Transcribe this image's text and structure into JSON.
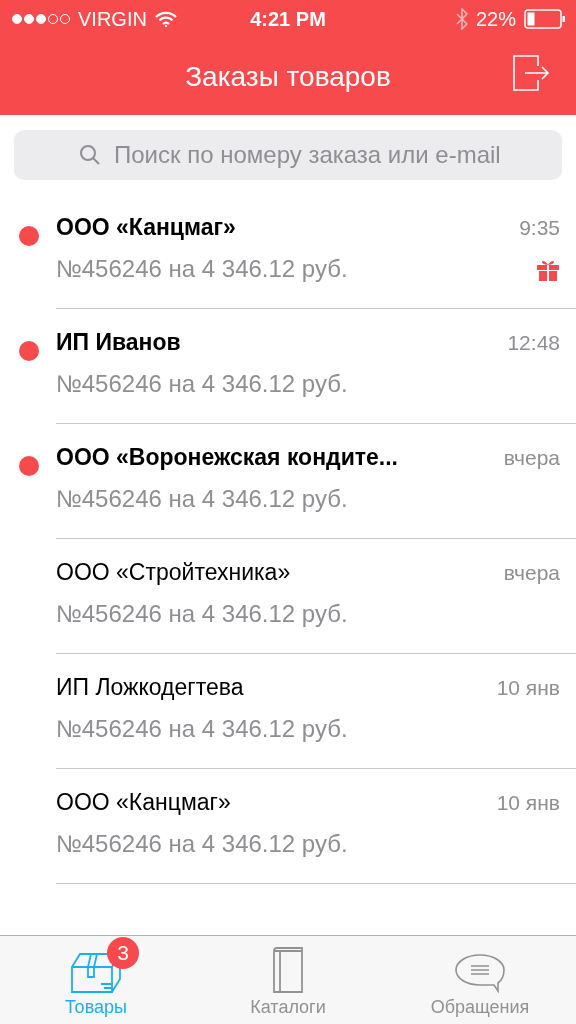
{
  "status_bar": {
    "carrier": "VIRGIN",
    "time": "4:21 PM",
    "battery": "22%"
  },
  "header": {
    "title": "Заказы товаров"
  },
  "search": {
    "placeholder": "Поиск по номеру заказа или e-mail"
  },
  "orders": [
    {
      "name": "ООО «Канцмаг»",
      "details": "№456246 на 4 346.12 руб.",
      "time": "9:35",
      "unread": true,
      "gift": true
    },
    {
      "name": "ИП Иванов",
      "details": "№456246 на 4 346.12 руб.",
      "time": "12:48",
      "unread": true,
      "gift": false
    },
    {
      "name": "ООО «Воронежская кондите...",
      "details": "№456246 на 4 346.12 руб.",
      "time": "вчера",
      "unread": true,
      "gift": false
    },
    {
      "name": "ООО «Стройтехника»",
      "details": "№456246 на 4 346.12 руб.",
      "time": "вчера",
      "unread": false,
      "gift": false
    },
    {
      "name": "ИП Ложкодегтева",
      "details": "№456246 на 4 346.12 руб.",
      "time": "10 янв",
      "unread": false,
      "gift": false
    },
    {
      "name": "ООО «Канцмаг»",
      "details": "№456246 на 4 346.12 руб.",
      "time": "10 янв",
      "unread": false,
      "gift": false
    }
  ],
  "tabs": [
    {
      "kind": "box",
      "label": "Товары",
      "selected": true,
      "badge": "3"
    },
    {
      "kind": "book",
      "label": "Каталоги",
      "selected": false
    },
    {
      "kind": "chat",
      "label": "Обращения",
      "selected": false
    }
  ]
}
